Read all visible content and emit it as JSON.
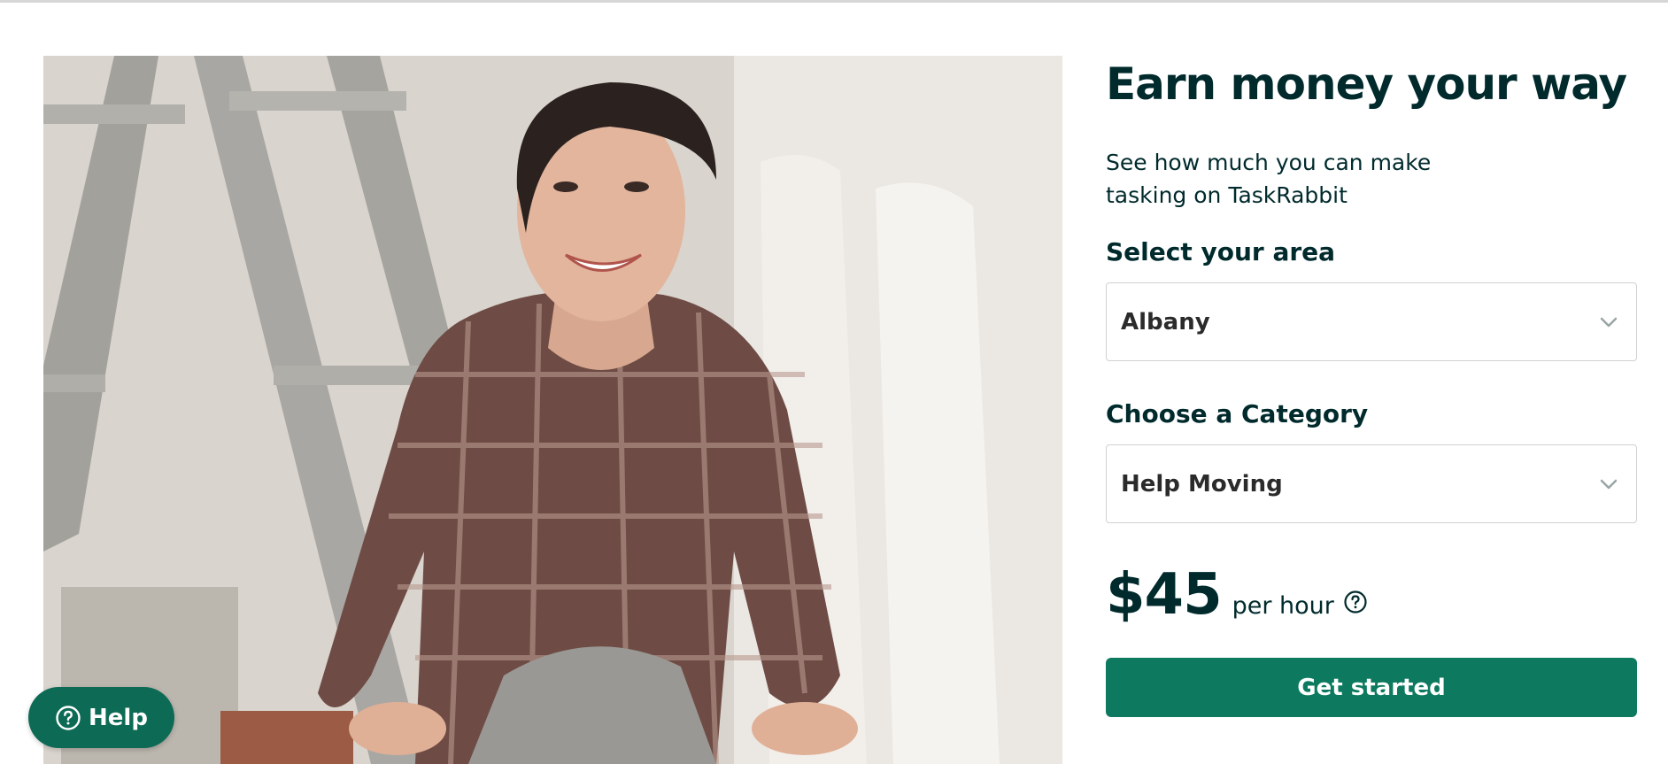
{
  "hero": {
    "image_description": "photo-woman-in-plaid-shirt-with-ladder"
  },
  "panel": {
    "headline": "Earn money your way",
    "subhead": "See how much you can make tasking on TaskRabbit",
    "area_label": "Select your area",
    "area_value": "Albany",
    "category_label": "Choose a Category",
    "category_value": "Help Moving",
    "rate_amount": "$45",
    "rate_unit": "per hour",
    "cta_label": "Get started"
  },
  "help": {
    "label": "Help"
  },
  "icons": {
    "select_chevron": "chevron-down-icon",
    "rate_info": "question-circle-icon",
    "help": "question-circle-icon"
  },
  "colors": {
    "text": "#002a2c",
    "cta": "#0d7a5f",
    "help_button": "#0d6b55",
    "border": "#d1d1d1"
  }
}
